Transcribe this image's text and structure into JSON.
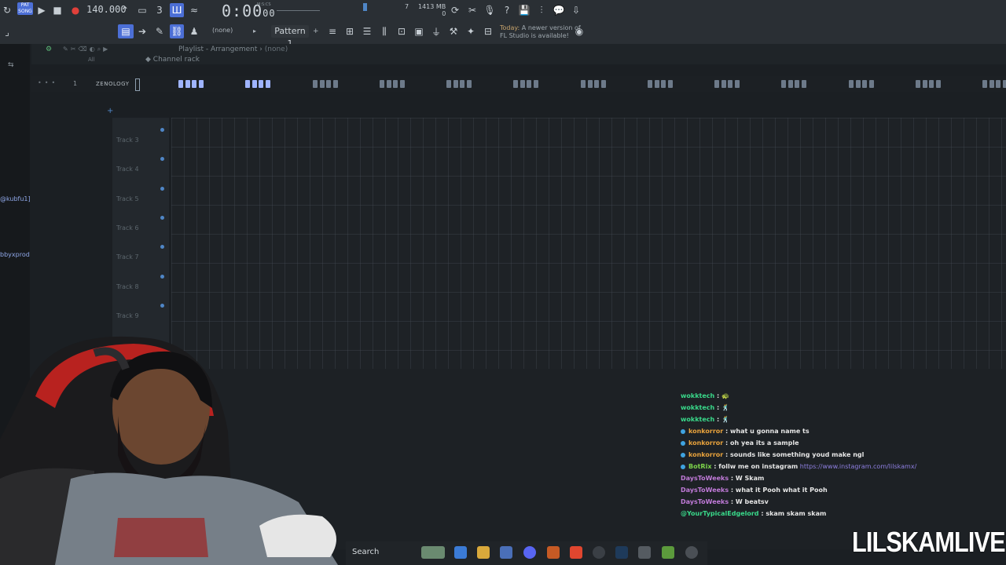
{
  "app": {
    "name": "FL Studio"
  },
  "toolbar": {
    "mode_label": "PAT",
    "song_label": "SONG",
    "tempo": "140.000",
    "time": "0:00",
    "time_sub": "00",
    "time_unit": "M:S:CS",
    "memory": "1413 MB",
    "memory_sub": "0",
    "cpu_value": "7",
    "snap": "(none)",
    "pattern": "Pattern 1",
    "news_line1": "Today:",
    "news_line1b": "A newer version of",
    "news_line2": "FL Studio is available!"
  },
  "playlist": {
    "title": "Playlist - Arrangement",
    "title_sep": "›",
    "pattern_ref": "(none)",
    "channel_rack": "Channel rack",
    "filter": "All",
    "pattern_num": "1",
    "pattern_name": "ZENOLOGY",
    "tracks": [
      "Track 3",
      "Track 4",
      "Track 5",
      "Track 6",
      "Track 7",
      "Track 8",
      "Track 9"
    ]
  },
  "left_panel": {
    "items": [
      "@kubfu1]",
      "bbyxprod"
    ]
  },
  "chat": {
    "messages": [
      {
        "user": "wokktech",
        "text": "",
        "color": "#39d98a",
        "badge": false,
        "emote": "🐢"
      },
      {
        "user": "wokktech",
        "text": "",
        "color": "#39d98a",
        "badge": false,
        "emote": "🕺"
      },
      {
        "user": "wokktech",
        "text": "",
        "color": "#39d98a",
        "badge": false,
        "emote": "🕺"
      },
      {
        "user": "konkorror",
        "text": "what u gonna name ts",
        "color": "#e8a23c",
        "badge": true
      },
      {
        "user": "konkorror",
        "text": "oh yea its a sample",
        "color": "#e8a23c",
        "badge": true
      },
      {
        "user": "konkorror",
        "text": "sounds like something youd make ngl",
        "color": "#e8a23c",
        "badge": true
      },
      {
        "user": "BotRix",
        "text": "follw me on instagram",
        "link": "https://www.instagram.com/lilskamx/",
        "color": "#7cd34a",
        "badge": true
      },
      {
        "user": "DaysToWeeks",
        "text": "W Skam",
        "color": "#c07ad8",
        "badge": false
      },
      {
        "user": "DaysToWeeks",
        "text": "what it Pooh what it Pooh",
        "color": "#c07ad8",
        "badge": false
      },
      {
        "user": "DaysToWeeks",
        "text": "W beatsv",
        "color": "#c07ad8",
        "badge": false
      },
      {
        "user": "@YourTypicalEdgelord",
        "text": "skam skam skam",
        "color": "#39d98a",
        "badge": false
      }
    ]
  },
  "taskbar": {
    "search": "Search"
  },
  "overlay": {
    "brand": "LILSKAMLIVE"
  },
  "colors": {
    "accent": "#4c6fd6",
    "pattern_block": "#9fb4ff"
  }
}
